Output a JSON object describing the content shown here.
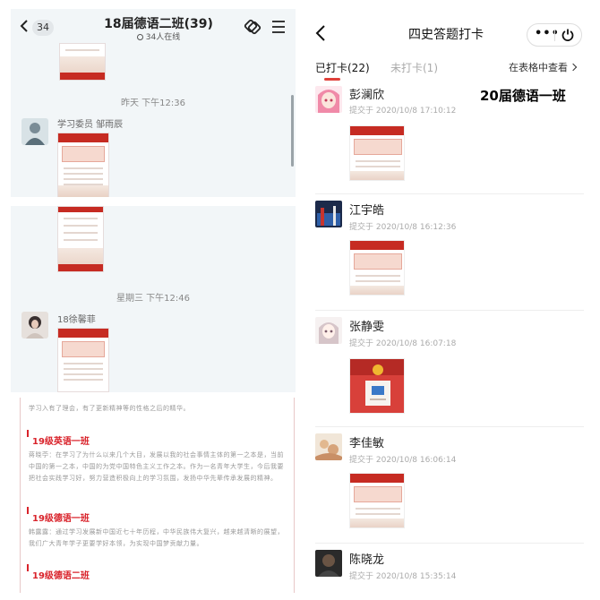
{
  "left": {
    "chat_header": {
      "unread_count": "34",
      "title": "18届德语二班(39)",
      "online": "34人在线"
    },
    "chat1": {
      "timestamp": "昨天 下午12:36",
      "sender": "学习委员 邹雨辰"
    },
    "chat2": {
      "timestamp": "星期三 下午12:46",
      "sender": "18徐馨菲"
    },
    "doc": {
      "intro_line": "学习入有了理会，有了更新精神等的性格之后的精华。",
      "sections": [
        {
          "heading": "19级英语一班",
          "text": "蒋晓苧：在学习了为什么以来几个大目，发展以我的社会事情主体的第一之本是，当前中国的第一之本，中国的为党中国特色主义工作之本。作为一名青年大学生，今后我要把社会实践学习好，努力营造积极向上的学习氛围，发扬中华先辈传承发展的精神。"
        },
        {
          "heading": "19级德语一班",
          "text": "韩露露：通过学习发展新中国近七十年历程，中华民族伟大复兴，越来越清晰的展望，我们广大青年学子更要学好本领，为实现中国梦贡献力量。"
        },
        {
          "heading": "19级德语二班",
          "text": ""
        }
      ]
    }
  },
  "right": {
    "title": "四史答题打卡",
    "tabs": [
      {
        "label": "已打卡(22)",
        "active": true
      },
      {
        "label": "未打卡(1)",
        "active": false
      }
    ],
    "view_in_table": "在表格中查看",
    "overlay_label": "20届德语一班",
    "entries": [
      {
        "name": "彭澜欣",
        "time": "提交于 2020/10/8 17:10:12",
        "avatar": "anime-girl-avatar"
      },
      {
        "name": "江宇皓",
        "time": "提交于 2020/10/8 16:12:36",
        "avatar": "photo-avatar"
      },
      {
        "name": "张静雯",
        "time": "提交于 2020/10/8 16:07:18",
        "avatar": "anime-girl-avatar"
      },
      {
        "name": "李佳敏",
        "time": "提交于 2020/10/8 16:06:14",
        "avatar": "illustration-avatar"
      },
      {
        "name": "陈晓龙",
        "time": "提交于 2020/10/8 15:35:14",
        "avatar": "photo-avatar"
      }
    ]
  },
  "colors": {
    "accent_red": "#e0403a",
    "doc_heading_red": "#d9232b",
    "chat_bg": "#f2f6f8"
  }
}
